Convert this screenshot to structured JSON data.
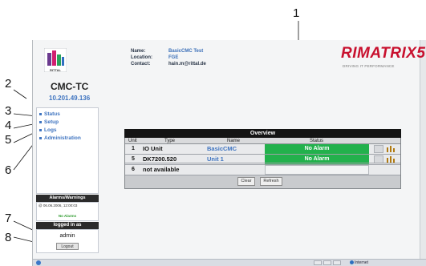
{
  "callouts": [
    "1",
    "2",
    "3",
    "4",
    "5",
    "6",
    "7",
    "8"
  ],
  "header": {
    "name_label": "Name:",
    "name_value": "BasicCMC Test",
    "location_label": "Location:",
    "location_value": "FGE",
    "contact_label": "Contact:",
    "contact_value": "hain.m@rittal.de"
  },
  "logo": {
    "text": "RITTAL"
  },
  "brand": {
    "word": "RIMATRIX5",
    "tagline": "DRIVING IT PERFORMANCE"
  },
  "device": {
    "title": "CMC-TC",
    "ip": "10.201.49.136"
  },
  "menu": {
    "items": [
      {
        "label": "Status"
      },
      {
        "label": "Setup"
      },
      {
        "label": "Logs"
      },
      {
        "label": "Administration"
      }
    ]
  },
  "alarms": {
    "heading": "Alarms/Warnings",
    "timestamp": "06.06.2006, 12:00:03",
    "status": "No Alarms"
  },
  "login": {
    "heading": "logged in as",
    "user": "admin",
    "logout_label": "Logout"
  },
  "overview": {
    "title": "Overview",
    "columns": [
      "Unit",
      "Type",
      "Name",
      "Status"
    ],
    "rows": [
      {
        "unit": "1",
        "type": "IO Unit",
        "name": "BasicCMC",
        "status": "No Alarm"
      },
      {
        "unit": "5",
        "type": "DK7200.520",
        "name": "Unit 1",
        "status": "No Alarm"
      },
      {
        "unit": "6",
        "type": "not available",
        "name": "",
        "status": ""
      }
    ],
    "clear_label": "Clear",
    "refresh_label": "Refresh"
  },
  "browser": {
    "zone_label": "Internet"
  },
  "colors": {
    "status_ok": "#22b14c",
    "link_blue": "#3f74c0",
    "brand_red": "#c8102e",
    "panel_dark": "#141414"
  },
  "icons": [
    "logo-icon",
    "edit-icon",
    "bars-icon",
    "ie-icon",
    "zone-icon"
  ]
}
